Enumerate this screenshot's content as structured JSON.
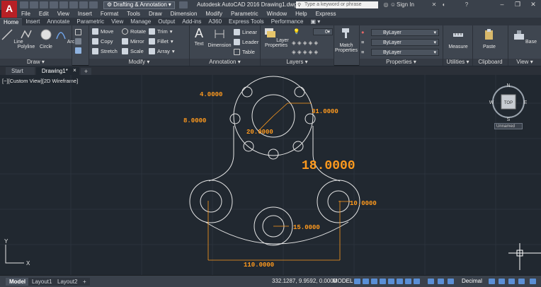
{
  "app": {
    "logo": "A",
    "title": "Autodesk AutoCAD 2016    Drawing1.dwg",
    "workspace": "Drafting & Annotation",
    "search_placeholder": "Type a keyword or phrase",
    "signin": "Sign In"
  },
  "menu": [
    "File",
    "Edit",
    "View",
    "Insert",
    "Format",
    "Tools",
    "Draw",
    "Dimension",
    "Modify",
    "Parametric",
    "Window",
    "Help",
    "Express"
  ],
  "ribbon_tabs": [
    "Home",
    "Insert",
    "Annotate",
    "Parametric",
    "View",
    "Manage",
    "Output",
    "Add-ins",
    "A360",
    "Express Tools",
    "Performance"
  ],
  "ribbon": {
    "draw": {
      "title": "Draw",
      "line": "Line",
      "polyline": "Polyline",
      "circle": "Circle",
      "arc": "Arc"
    },
    "modify": {
      "title": "Modify",
      "move": "Move",
      "rotate": "Rotate",
      "trim": "Trim",
      "copy": "Copy",
      "mirror": "Mirror",
      "fillet": "Fillet",
      "stretch": "Stretch",
      "scale": "Scale",
      "array": "Array"
    },
    "annotation": {
      "title": "Annotation",
      "text": "Text",
      "dimension": "Dimension",
      "linear": "Linear",
      "leader": "Leader",
      "table": "Table"
    },
    "layers": {
      "title": "Layers",
      "layer_properties": "Layer Properties",
      "layer_value": "0"
    },
    "block": {
      "match_properties": "Match Properties"
    },
    "properties": {
      "title": "Properties",
      "color": "ByLayer",
      "linetype": "ByLayer",
      "lineweight": "ByLayer"
    },
    "utilities": {
      "title": "Utilities",
      "measure": "Measure"
    },
    "clipboard": {
      "title": "Clipboard",
      "paste": "Paste"
    },
    "view": {
      "title": "View",
      "base": "Base"
    }
  },
  "doc_tabs": {
    "start": "Start",
    "drawing": "Drawing1*",
    "plus": "+"
  },
  "viewport": {
    "label": "[−][Custom View][2D Wireframe]",
    "viewcube": {
      "top": "TOP",
      "n": "N",
      "s": "S",
      "e": "E",
      "w": "W",
      "ucs": "Unnamed"
    },
    "dims": {
      "d1": "4.0000",
      "d2": "8.0000",
      "d3": "31.0000",
      "d4": "20.0000",
      "d5": "18.0000",
      "d6": "10.0000",
      "d7": "15.0000",
      "d8": "110.0000"
    },
    "ucs_y": "Y",
    "ucs_x": "X"
  },
  "status": {
    "layout_tabs": [
      "Model",
      "Layout1",
      "Layout2"
    ],
    "plus": "+",
    "coords": "332.1287, 9.9592, 0.0000",
    "model": "MODEL",
    "units": "Decimal"
  },
  "colors": {
    "dim": "#ff9a1e",
    "geometry": "#e6e6e6",
    "background": "#212830"
  }
}
